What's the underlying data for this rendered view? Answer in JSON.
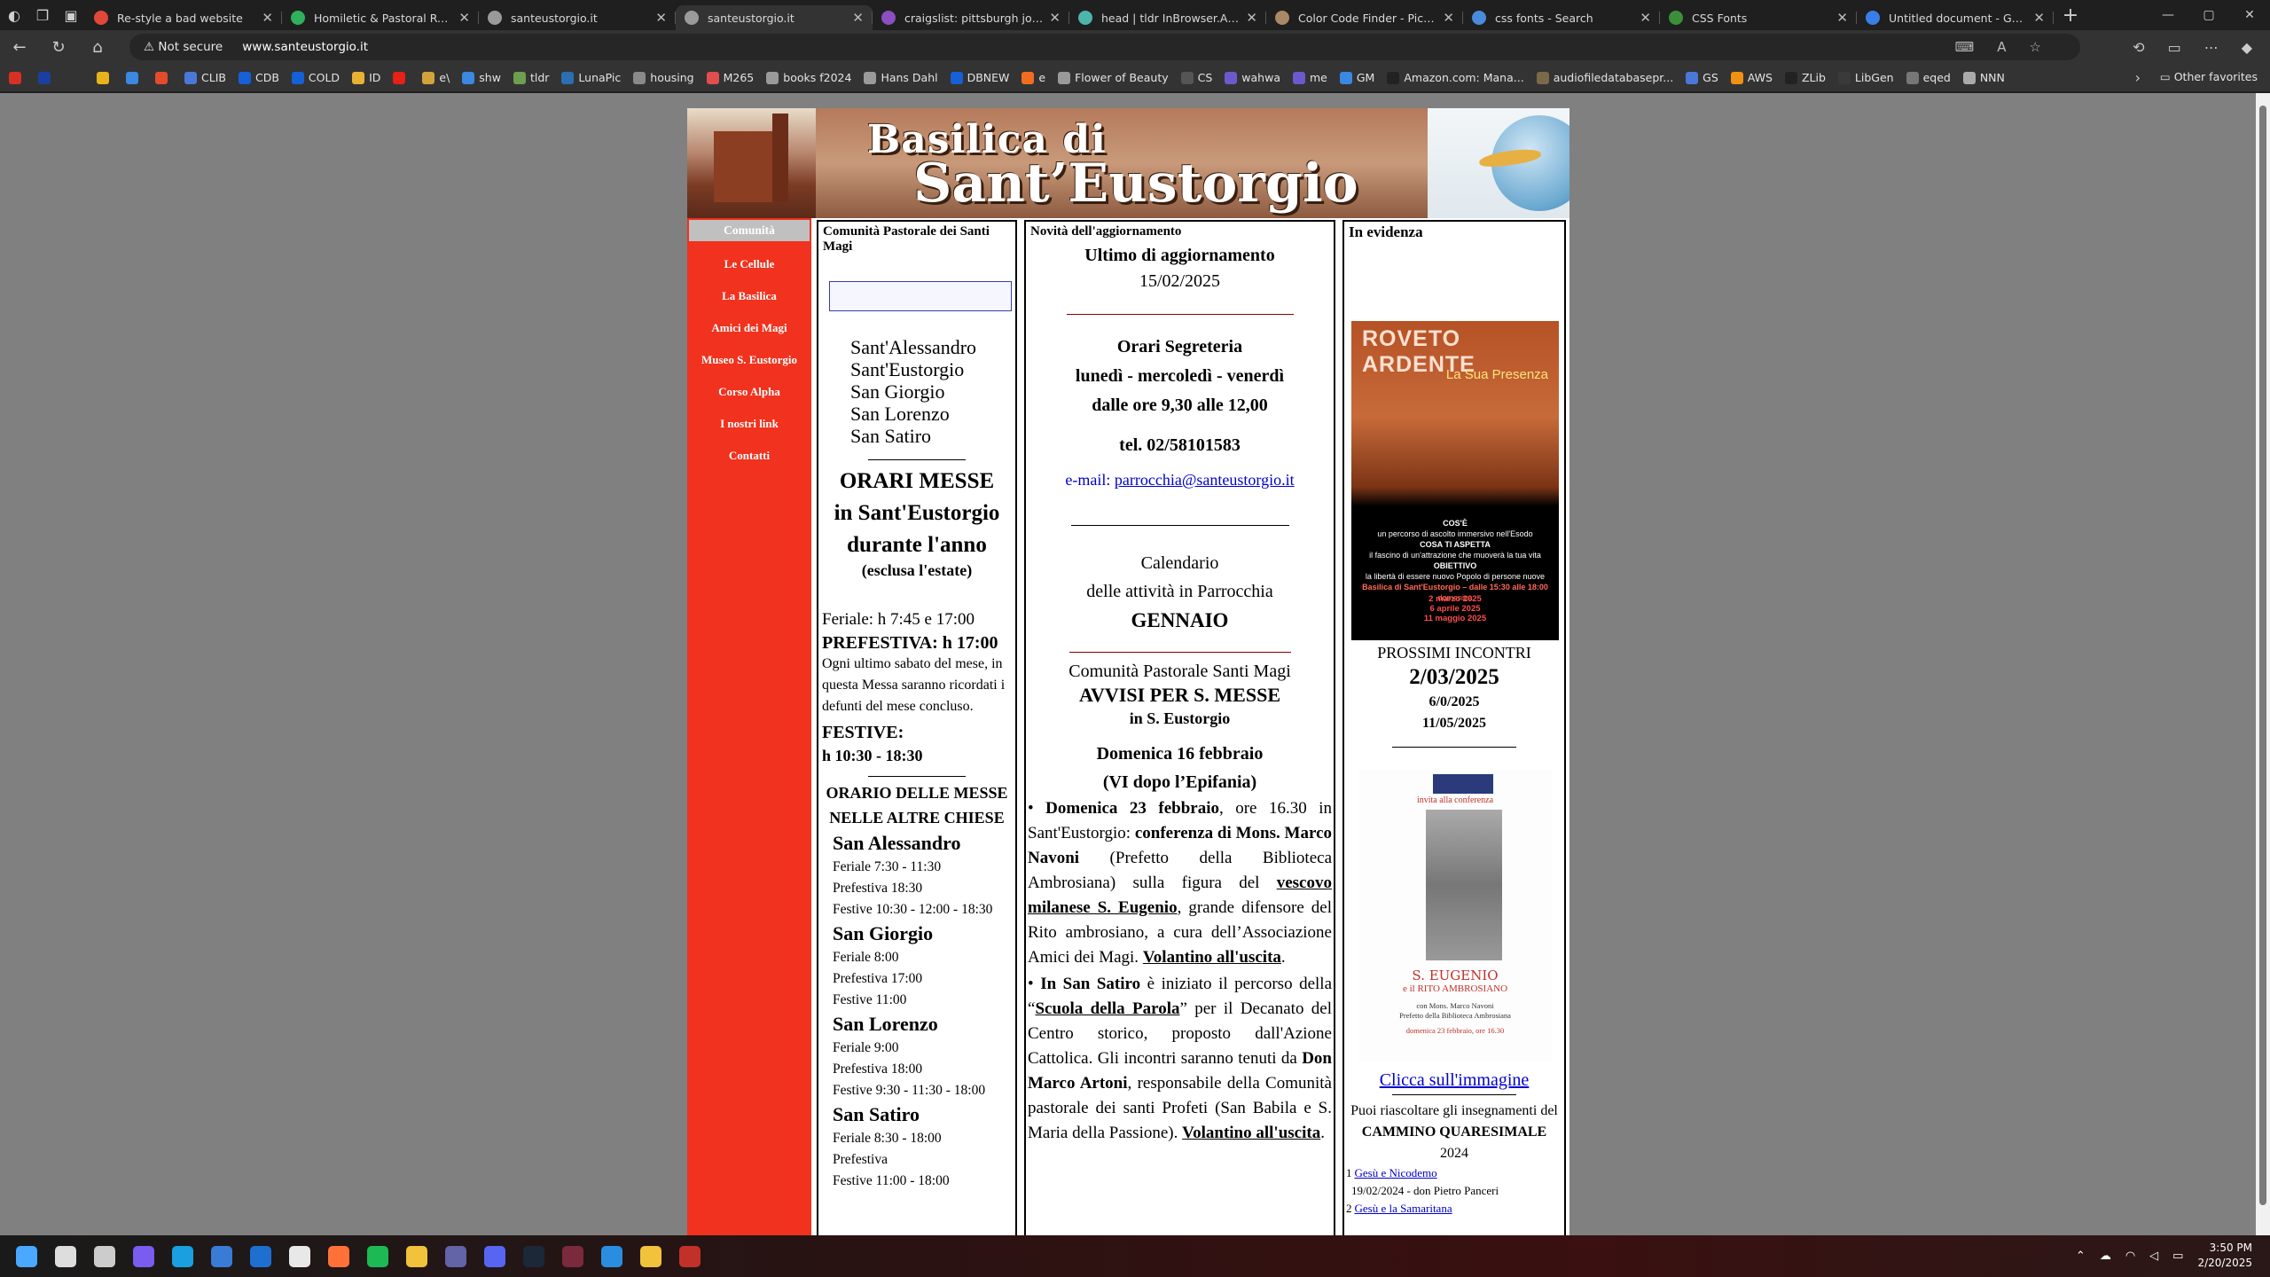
{
  "browser": {
    "tabs": [
      {
        "title": "Re-style a bad website",
        "color": "#e3473b"
      },
      {
        "title": "Homiletic & Pastoral Review -",
        "color": "#2fb15c"
      },
      {
        "title": "santeustorgio.it",
        "color": "#9a9a9a"
      },
      {
        "title": "santeustorgio.it",
        "color": "#9a9a9a"
      },
      {
        "title": "craigslist: pittsburgh jobs, apa",
        "color": "#8b4fbf"
      },
      {
        "title": "head | tldr InBrowser.App",
        "color": "#4db6ac"
      },
      {
        "title": "Color Code Finder - Pick Hex/R",
        "color": "#aa8866"
      },
      {
        "title": "css fonts - Search",
        "color": "#4a8bdc"
      },
      {
        "title": "CSS Fonts",
        "color": "#3b8f3b"
      },
      {
        "title": "Untitled document - Google D",
        "color": "#3b7de6"
      }
    ],
    "active_tab_index": 3,
    "security": "Not secure",
    "url": "www.santeustorgio.it",
    "bookmarks": [
      {
        "label": "",
        "color": "#d93025"
      },
      {
        "label": "",
        "color": "#1a3fa0"
      },
      {
        "label": "",
        "color": "#333333"
      },
      {
        "label": "",
        "color": "#e8b31c"
      },
      {
        "label": "",
        "color": "#3a88e0"
      },
      {
        "label": "",
        "color": "#e34b2c"
      },
      {
        "label": "CLIB",
        "color": "#4a78d8"
      },
      {
        "label": "CDB",
        "color": "#1560d6"
      },
      {
        "label": "COLD",
        "color": "#1560d6"
      },
      {
        "label": "ID",
        "color": "#e7b233"
      },
      {
        "label": "",
        "color": "#e62117"
      },
      {
        "label": "e\\",
        "color": "#d2a33b"
      },
      {
        "label": "shw",
        "color": "#3a88e0"
      },
      {
        "label": "tldr",
        "color": "#6d9f4f"
      },
      {
        "label": "LunaPic",
        "color": "#2b6fb3"
      },
      {
        "label": "housing",
        "color": "#8a8a8a"
      },
      {
        "label": "M265",
        "color": "#e24d4d"
      },
      {
        "label": "books f2024",
        "color": "#9a9a9a"
      },
      {
        "label": "Hans Dahl",
        "color": "#9a9a9a"
      },
      {
        "label": "DBNEW",
        "color": "#1560d6"
      },
      {
        "label": "e",
        "color": "#f26d21"
      },
      {
        "label": "Flower of Beauty",
        "color": "#9a9a9a"
      },
      {
        "label": "CS",
        "color": "#555555"
      },
      {
        "label": "wahwa",
        "color": "#6a5acd"
      },
      {
        "label": "me",
        "color": "#6a5acd"
      },
      {
        "label": "GM",
        "color": "#3a88e0"
      },
      {
        "label": "Amazon.com: Mana...",
        "color": "#222222"
      },
      {
        "label": "audiofiledatabasepr...",
        "color": "#7a6a4a"
      },
      {
        "label": "GS",
        "color": "#4a78d8"
      },
      {
        "label": "AWS",
        "color": "#f29111"
      },
      {
        "label": "ZLib",
        "color": "#222222"
      },
      {
        "label": "LibGen",
        "color": "#3a3a3a"
      },
      {
        "label": "eqed",
        "color": "#777777"
      },
      {
        "label": "NNN",
        "color": "#aaaaaa"
      }
    ],
    "other_favorites": "Other favorites"
  },
  "site": {
    "banner": {
      "line1": "Basilica di",
      "line2": "Sant’Eustorgio"
    },
    "nav": [
      {
        "label": "Comunità",
        "current": true
      },
      {
        "label": "Le Cellule"
      },
      {
        "label": "La Basilica"
      },
      {
        "label": "Amici dei Magi"
      },
      {
        "label": "Museo S. Eustorgio"
      },
      {
        "label": "Corso Alpha"
      },
      {
        "label": "I nostri link"
      },
      {
        "label": "Contatti"
      }
    ],
    "col1": {
      "title": "Comunità Pastorale dei Santi Magi",
      "churches": [
        "Sant'Alessandro",
        "Sant'Eustorgio",
        "San Giorgio",
        "San Lorenzo",
        "San Satiro"
      ],
      "orari_title1": "ORARI MESSE",
      "orari_title2": "in Sant'Eustorgio",
      "orari_title3": "durante l'anno",
      "orari_note": "(esclusa l'estate)",
      "feriale": "Feriale: h 7:45 e 17:00",
      "prefestiva": "PREFESTIVA: h 17:00",
      "prefestiva_note": "Ogni ultimo sabato del mese, in questa Messa saranno ricordati i defunti del mese concluso.",
      "festive_label": "FESTIVE:",
      "festive_hours": "h 10:30 - 18:30",
      "altre_title": "ORARIO DELLE MESSE NELLE ALTRE CHIESE",
      "altre": [
        {
          "name": "San Alessandro",
          "lines": [
            "Feriale 7:30 - 11:30",
            "Prefestiva 18:30",
            "Festive 10:30 - 12:00 - 18:30"
          ]
        },
        {
          "name": "San Giorgio",
          "lines": [
            "Feriale 8:00",
            "Prefestiva 17:00",
            "Festive 11:00"
          ]
        },
        {
          "name": "San Lorenzo",
          "lines": [
            "Feriale 9:00",
            "Prefestiva 18:00",
            "Festive 9:30 - 11:30 - 18:00"
          ]
        },
        {
          "name": "San Satiro",
          "lines": [
            "Feriale 8:30 - 18:00",
            "Prefestiva",
            "Festive 11:00 - 18:00"
          ]
        }
      ]
    },
    "col2": {
      "title": "Novità dell'aggiornamento",
      "update_label": "Ultimo di aggiornamento",
      "update_date": "15/02/2025",
      "seg_title": "Orari Segreteria",
      "seg_days": "lunedì - mercoledì - venerdì",
      "seg_hours": "dalle ore 9,30 alle 12,00",
      "tel": "tel. 02/58101583",
      "email_label": "e-mail:",
      "email": "parrocchia@santeustorgio.it",
      "cal1": "Calendario",
      "cal2": "delle attività in Parrocchia",
      "cal_month": "GENNAIO",
      "comm": "Comunità Pastorale Santi Magi",
      "avvisi": "AVVISI PER S. MESSE",
      "avvisi_loc": "in S. Eustorgio",
      "domenica": "Domenica 16 febbraio",
      "domenica_sub": "(VI dopo l’Epifania)",
      "p1": {
        "bullet_b": "Domenica 23 febbraio",
        "t1": ", ore 16.30 in Sant'Eustorgio: ",
        "b2": "conferenza di Mons. Marco Navoni",
        "t2": " (Prefetto della Biblioteca Ambrosiana) sulla figura del ",
        "u3": "vescovo milanese S. Eugenio",
        "t3": ", grande difensore del Rito ambrosiano, a cura dell’Associazione Amici dei Magi. ",
        "u4": "Volantino all'uscita",
        "t4": "."
      },
      "p2": {
        "bullet_b": "In San Satiro",
        "t1": " è iniziato il percorso della “",
        "u2": "Scuola della Parola",
        "t2": "” per il Decanato del Centro storico, proposto dall'Azione Cattolica. Gli incontri saranno tenuti da ",
        "b3": "Don Marco Artoni",
        "t3": ", responsabile della Comunità pastorale dei santi Profeti (San Babila e S. Maria della Passione). ",
        "u4": "Volantino all'uscita",
        "t4": "."
      }
    },
    "col3": {
      "title": "In evidenza",
      "poster1": {
        "title": "ROVETO ARDENTE",
        "subtitle": "La Sua Presenza",
        "lines": [
          "COS'È",
          "un percorso di ascolto immersivo nell'Esodo",
          "COSA TI ASPETTA",
          "il fascino di un'attrazione che muoverà la tua vita",
          "OBIETTIVO",
          "la libertà di essere nuovo Popolo di persone nuove",
          "Basilica di Sant'Eustorgio – dalle 15:30 alle 18:00",
          "domenica"
        ],
        "dates": [
          "2 marzo 2025",
          "6 aprile 2025",
          "11 maggio 2025"
        ]
      },
      "prossimi": "PROSSIMI INCONTRI",
      "date1": "2/03/2025",
      "date2": "6/0/2025",
      "date3": "11/05/2025",
      "poster2": {
        "invite": "invita alla conferenza",
        "title": "S. EUGENIO",
        "subtitle": "e il RITO AMBROSIANO",
        "speaker": "con Mons. Marco Navoni",
        "role": "Prefetto della Biblioteca Ambrosiana",
        "when": "domenica 23 febbraio, ore 16.30"
      },
      "click": "Clicca sull'immagine",
      "ascolto1": "Puoi riascoltare gli insegnamenti del",
      "cammino": "CAMMINO QUARESIMALE",
      "year": "2024",
      "items": [
        {
          "num": "1",
          "link": "Gesù e Nicodemo",
          "sub": "19/02/2024 - don Pietro Panceri"
        },
        {
          "num": "2",
          "link": "Gesù e la Samaritana",
          "sub": ""
        }
      ]
    }
  },
  "taskbar": {
    "time": "3:50 PM",
    "date": "2/20/2025",
    "apps": [
      {
        "name": "start",
        "color": "#4aa8ff"
      },
      {
        "name": "search",
        "color": "#dddddd"
      },
      {
        "name": "taskview",
        "color": "#cccccc"
      },
      {
        "name": "copilot",
        "color": "#7a5cf0"
      },
      {
        "name": "edge",
        "color": "#1a9fe0"
      },
      {
        "name": "store",
        "color": "#3a7bd5"
      },
      {
        "name": "outlook",
        "color": "#1f6fd1"
      },
      {
        "name": "chrome",
        "color": "#e8e8e8"
      },
      {
        "name": "firefox",
        "color": "#ff7139"
      },
      {
        "name": "spotify",
        "color": "#1db954"
      },
      {
        "name": "explorer",
        "color": "#f2c23c"
      },
      {
        "name": "teams",
        "color": "#6264a7"
      },
      {
        "name": "discord",
        "color": "#5865f2"
      },
      {
        "name": "steam",
        "color": "#1b2838"
      },
      {
        "name": "cursor",
        "color": "#7a2a3a"
      },
      {
        "name": "vscode",
        "color": "#2a8ee0"
      },
      {
        "name": "notes",
        "color": "#f2c23c"
      },
      {
        "name": "app",
        "color": "#c2302a"
      }
    ]
  }
}
